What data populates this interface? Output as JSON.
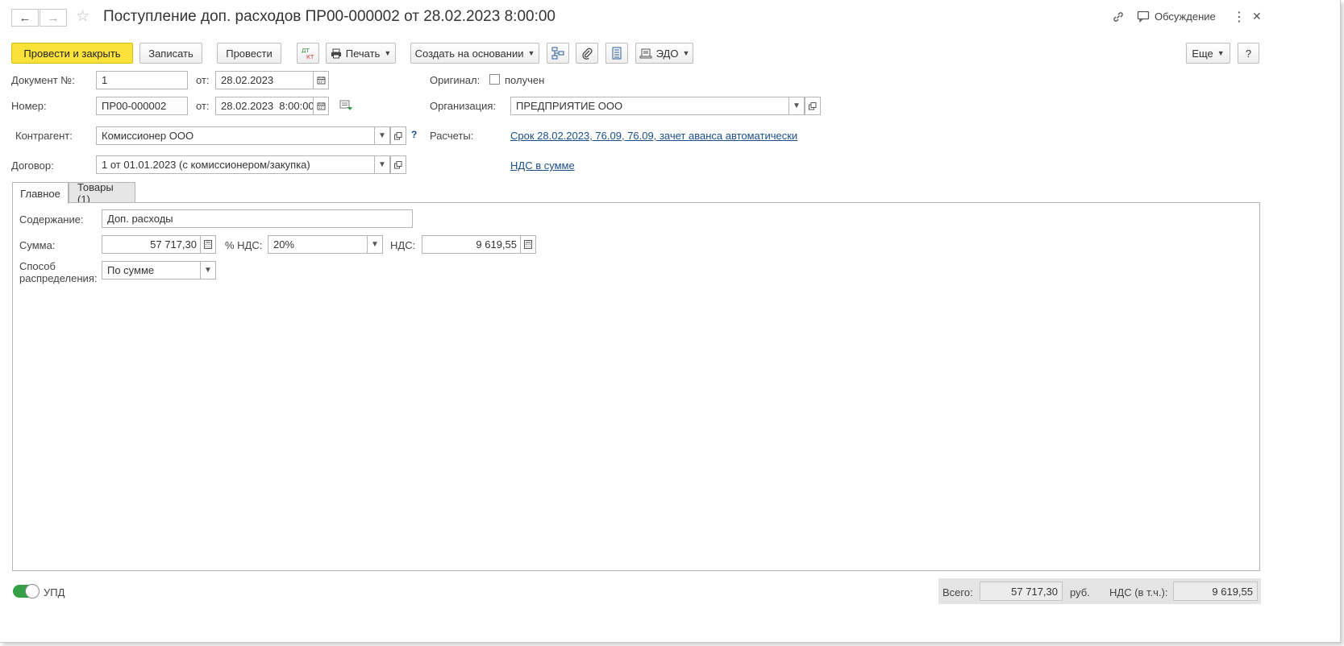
{
  "window": {
    "title": "Поступление доп. расходов ПР00-000002 от 28.02.2023 8:00:00",
    "back_icon": "←",
    "forward_icon": "→",
    "star_icon": "☆",
    "link_icon": "🔗",
    "discussion_label": "Обсуждение",
    "menu_icon": "⋮",
    "close_icon": "✕"
  },
  "toolbar": {
    "post_close_label": "Провести и закрыть",
    "save_label": "Записать",
    "post_label": "Провести",
    "print_label": "Печать",
    "create_based_label": "Создать на основании",
    "edo_label": "ЭДО",
    "more_label": "Еще",
    "help_label": "?"
  },
  "header": {
    "doc_no_label": "Документ №:",
    "doc_no_value": "1",
    "from_label": "от:",
    "doc_date_value": "28.02.2023",
    "number_label": "Номер:",
    "number_value": "ПР00-000002",
    "number_date_value": "28.02.2023  8:00:00",
    "original_label": "Оригинал:",
    "received_label": "получен",
    "organization_label": "Организация:",
    "organization_value": "ПРЕДПРИЯТИЕ ООО",
    "counterparty_label": "Контрагент:",
    "counterparty_value": "Комиссионер ООО",
    "settlements_label": "Расчеты:",
    "settlements_link": "Срок 28.02.2023, 76.09, 76.09, зачет аванса автоматически",
    "contract_label": "Договор:",
    "contract_value": "1 от 01.01.2023 (с комиссионером/закупка)",
    "vat_link": "НДС в сумме"
  },
  "tabs": [
    {
      "label": "Главное"
    },
    {
      "label": "Товары (1)"
    }
  ],
  "main": {
    "content_label": "Содержание:",
    "content_value": "Доп. расходы",
    "sum_label": "Сумма:",
    "sum_value": "57 717,30",
    "vat_rate_label": "% НДС:",
    "vat_rate_value": "20%",
    "vat_label": "НДС:",
    "vat_value": "9 619,55",
    "distribution_label_1": "Способ",
    "distribution_label_2": "распределения:",
    "distribution_value": "По сумме"
  },
  "footer": {
    "upd_label": "УПД",
    "total_label": "Всего:",
    "total_value": "57 717,30",
    "currency": "руб.",
    "vat_incl_label": "НДС (в т.ч.):",
    "vat_incl_value": "9 619,55"
  }
}
